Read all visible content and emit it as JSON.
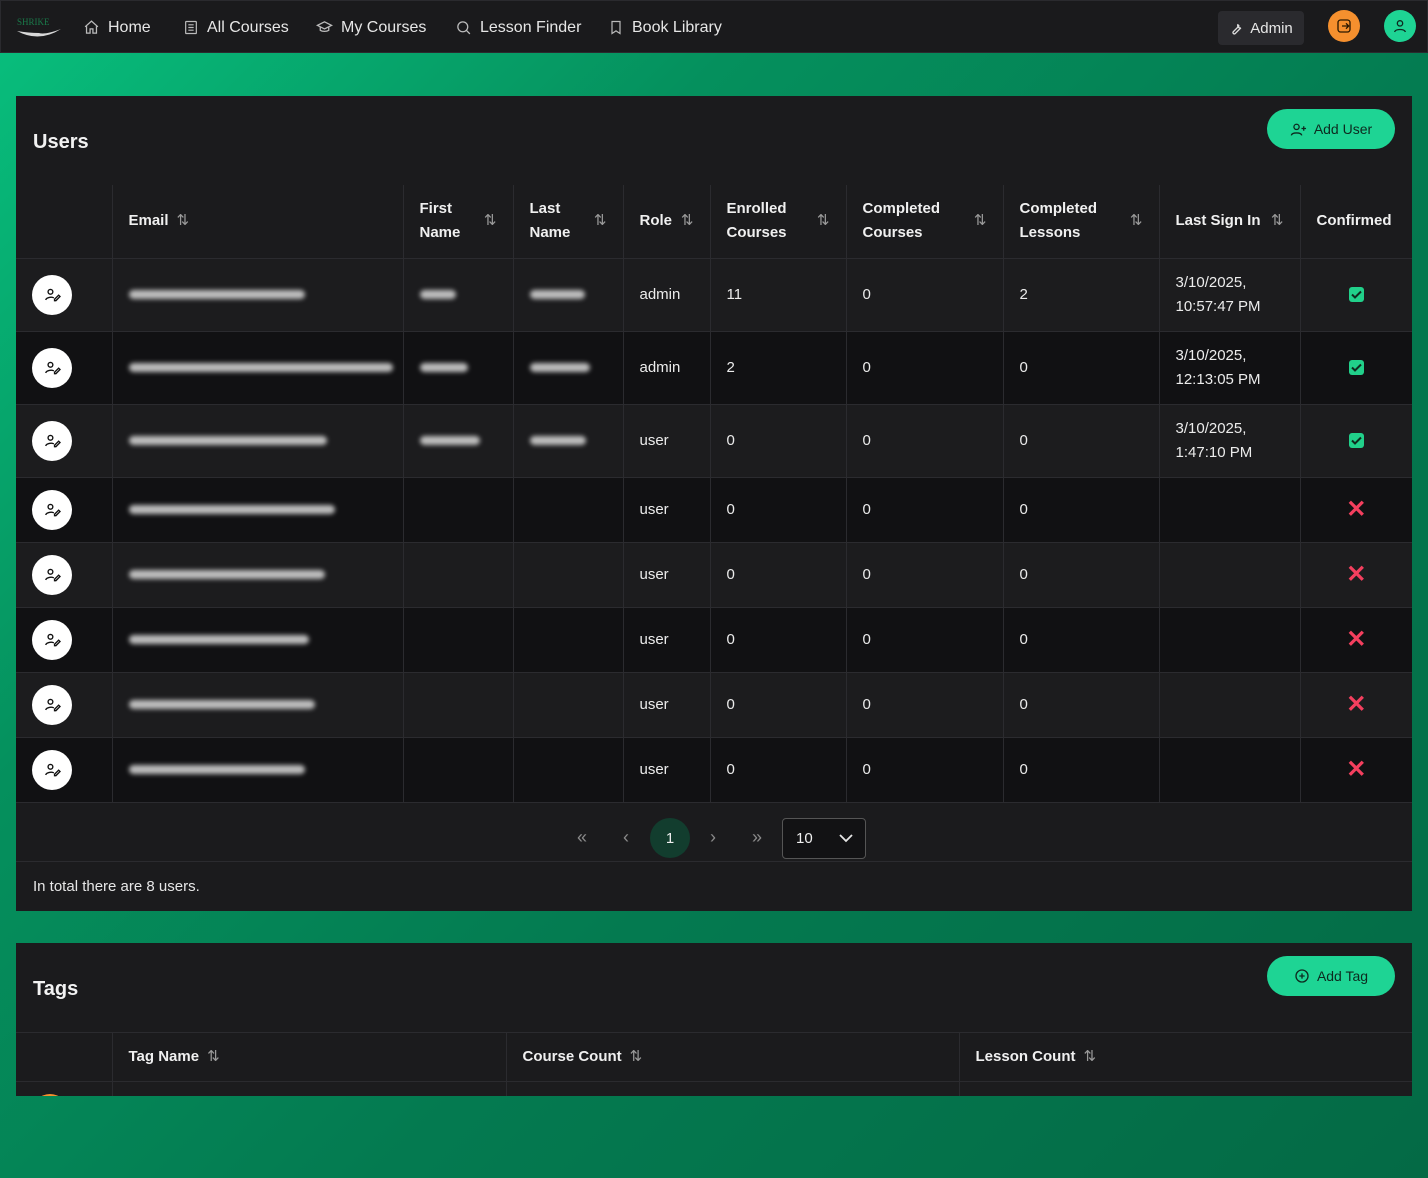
{
  "nav": {
    "logo_text": "SHRIKE",
    "items": [
      {
        "label": "Home",
        "icon": "home-icon"
      },
      {
        "label": "All Courses",
        "icon": "document-icon"
      },
      {
        "label": "My Courses",
        "icon": "graduation-cap-icon"
      },
      {
        "label": "Lesson Finder",
        "icon": "search-icon"
      },
      {
        "label": "Book Library",
        "icon": "bookmark-icon"
      }
    ],
    "admin_label": "Admin",
    "colors": {
      "logout": "#f5902e",
      "profile": "#1ed494"
    }
  },
  "users": {
    "title": "Users",
    "add_label": "Add User",
    "columns": [
      "",
      "Email",
      "First Name",
      "Last Name",
      "Role",
      "Enrolled Courses",
      "Completed Courses",
      "Completed Lessons",
      "Last Sign In",
      "Confirmed"
    ],
    "rows": [
      {
        "role": "admin",
        "enrolled": "11",
        "completed_courses": "0",
        "completed_lessons": "2",
        "last_sign_in_date": "3/10/2025,",
        "last_sign_in_time": "10:57:47 PM",
        "confirmed": true
      },
      {
        "role": "admin",
        "enrolled": "2",
        "completed_courses": "0",
        "completed_lessons": "0",
        "last_sign_in_date": "3/10/2025,",
        "last_sign_in_time": "12:13:05 PM",
        "confirmed": true
      },
      {
        "role": "user",
        "enrolled": "0",
        "completed_courses": "0",
        "completed_lessons": "0",
        "last_sign_in_date": "3/10/2025,",
        "last_sign_in_time": "1:47:10 PM",
        "confirmed": true
      },
      {
        "role": "user",
        "enrolled": "0",
        "completed_courses": "0",
        "completed_lessons": "0",
        "last_sign_in_date": "",
        "last_sign_in_time": "",
        "confirmed": false
      },
      {
        "role": "user",
        "enrolled": "0",
        "completed_courses": "0",
        "completed_lessons": "0",
        "last_sign_in_date": "",
        "last_sign_in_time": "",
        "confirmed": false
      },
      {
        "role": "user",
        "enrolled": "0",
        "completed_courses": "0",
        "completed_lessons": "0",
        "last_sign_in_date": "",
        "last_sign_in_time": "",
        "confirmed": false
      },
      {
        "role": "user",
        "enrolled": "0",
        "completed_courses": "0",
        "completed_lessons": "0",
        "last_sign_in_date": "",
        "last_sign_in_time": "",
        "confirmed": false
      },
      {
        "role": "user",
        "enrolled": "0",
        "completed_courses": "0",
        "completed_lessons": "0",
        "last_sign_in_date": "",
        "last_sign_in_time": "",
        "confirmed": false
      }
    ],
    "pagination": {
      "first": "«",
      "prev": "‹",
      "current": "1",
      "next": "›",
      "last": "»",
      "page_size": "10"
    },
    "total_text": "In total there are 8 users."
  },
  "tags": {
    "title": "Tags",
    "add_label": "Add Tag",
    "columns": [
      "",
      "Tag Name",
      "Course Count",
      "Lesson Count"
    ]
  }
}
